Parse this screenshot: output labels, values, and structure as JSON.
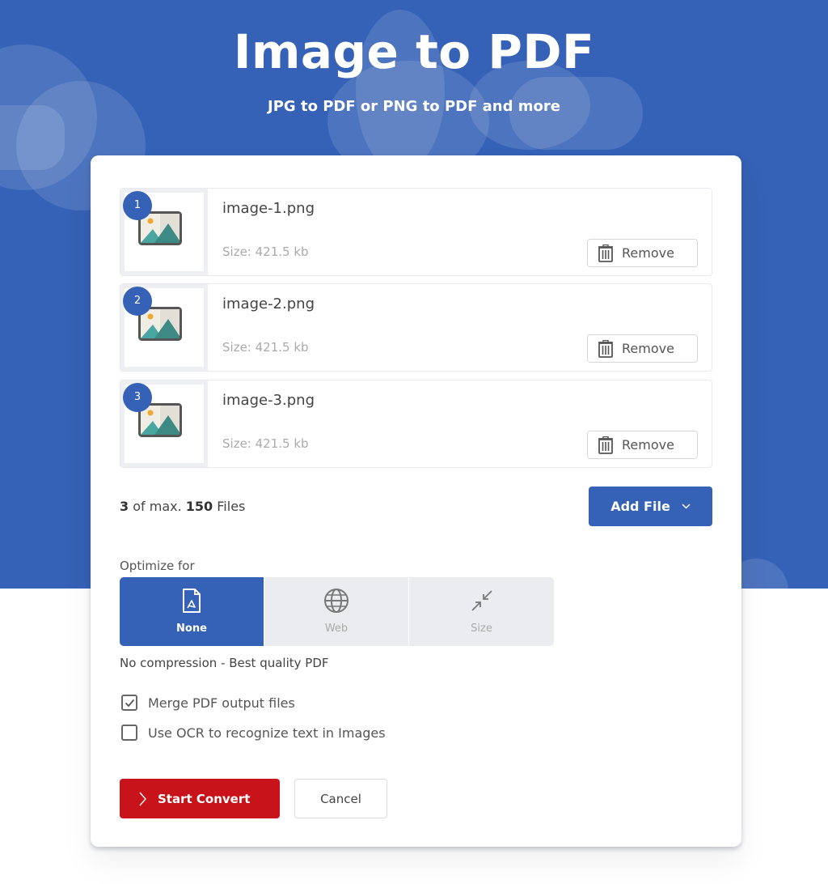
{
  "header": {
    "title": "Image to PDF",
    "subtitle": "JPG to PDF or PNG to PDF and more"
  },
  "colors": {
    "brand_blue": "#3561b6",
    "primary_red": "#c8131a"
  },
  "files": [
    {
      "index": "1",
      "name": "image-1.png",
      "size": "Size: 421.5 kb",
      "remove_label": "Remove"
    },
    {
      "index": "2",
      "name": "image-2.png",
      "size": "Size: 421.5 kb",
      "remove_label": "Remove"
    },
    {
      "index": "3",
      "name": "image-3.png",
      "size": "Size: 421.5 kb",
      "remove_label": "Remove"
    }
  ],
  "file_count": {
    "current": "3",
    "middle": " of max. ",
    "max": "150",
    "suffix": " Files"
  },
  "add_file": {
    "label": "Add File",
    "icon": "chevron-down-icon"
  },
  "optimize": {
    "label": "Optimize for",
    "options": [
      {
        "label": "None",
        "icon": "pdf-file-icon",
        "selected": true
      },
      {
        "label": "Web",
        "icon": "globe-icon",
        "selected": false
      },
      {
        "label": "Size",
        "icon": "compress-arrows-icon",
        "selected": false
      }
    ],
    "description": "No compression - Best quality PDF"
  },
  "options": {
    "merge": {
      "label": "Merge PDF output files",
      "checked": true
    },
    "ocr": {
      "label": "Use OCR to recognize text in Images",
      "checked": false
    }
  },
  "actions": {
    "start_label": "Start Convert",
    "cancel_label": "Cancel"
  }
}
